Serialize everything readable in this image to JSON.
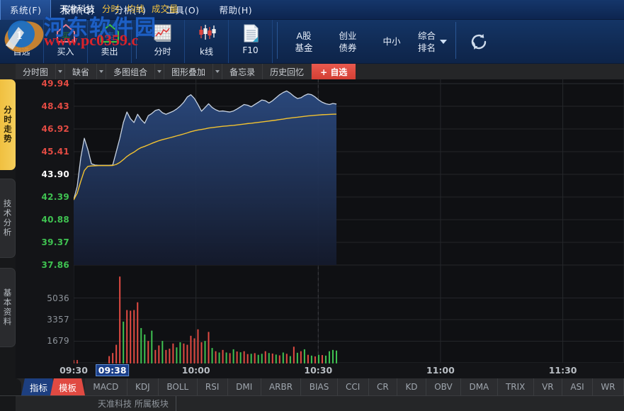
{
  "menu": {
    "items": [
      {
        "label": "系统(F)",
        "active": true
      },
      {
        "label": "报价(Q)",
        "active": false
      },
      {
        "label": "分析(T)",
        "active": false
      },
      {
        "label": "工具(O)",
        "active": false
      },
      {
        "label": "帮助(H)",
        "active": false
      }
    ]
  },
  "watermark": {
    "site_name": "河东软件园",
    "site_url": "www.pc0359.c"
  },
  "toolbar": {
    "icon_buttons": [
      {
        "label": "自选",
        "icon": "cart-icon"
      },
      {
        "label": "买入",
        "icon": "buy-house-icon"
      },
      {
        "label": "卖出",
        "icon": "sell-house-icon"
      },
      {
        "label": "分时",
        "icon": "timeline-chart-icon"
      },
      {
        "label": "k线",
        "icon": "candlestick-icon"
      },
      {
        "label": "F10",
        "icon": "document-icon"
      }
    ],
    "market_buttons": [
      {
        "line1": "A股",
        "line2": "基金"
      },
      {
        "line1": "创业",
        "line2": "债券"
      }
    ],
    "single_buttons": [
      {
        "label": "中小"
      }
    ],
    "rank_button": {
      "line1": "综合",
      "line2": "排名",
      "icon": "chevron-down-icon"
    },
    "refresh_button": {
      "icon": "refresh-icon"
    }
  },
  "subbar": {
    "buttons": [
      {
        "label": "分时图",
        "has_arrow": true
      },
      {
        "label": "缺省",
        "has_arrow": true
      },
      {
        "label": "多图组合",
        "has_arrow": true
      },
      {
        "label": "图形叠加",
        "has_arrow": true
      },
      {
        "label": "备忘录",
        "has_arrow": false
      },
      {
        "label": "历史回忆",
        "has_arrow": false
      }
    ],
    "add_favorite": "+ 自选"
  },
  "side_tabs": [
    {
      "label": "分时走势",
      "selected": true
    },
    {
      "label": "技术分析",
      "selected": false
    },
    {
      "label": "基本资料",
      "selected": false
    }
  ],
  "chart_header": {
    "stock_name": "天准科技",
    "tags": [
      "分时",
      "均线",
      "成交量"
    ]
  },
  "status_bar": {
    "text": "天准科技  所属板块"
  },
  "indicator_bar": {
    "tabs": [
      {
        "label": "指标",
        "style": "blue"
      },
      {
        "label": "模板",
        "style": "red"
      }
    ],
    "buttons": [
      "MACD",
      "KDJ",
      "BOLL",
      "RSI",
      "DMI",
      "ARBR",
      "BIAS",
      "CCI",
      "CR",
      "KD",
      "OBV",
      "DMA",
      "TRIX",
      "VR",
      "ASI",
      "WR"
    ]
  },
  "colors": {
    "up_red": "#e24b43",
    "down_green": "#3fc251",
    "neutral_white": "#ffffff",
    "avg_line_yellow": "#f2c230",
    "price_line": "#c8d3e2",
    "fill_blue": "#1d3b6e",
    "accent_gold": "#f0c040",
    "accent_red": "#d43f34",
    "menu_blue": "#15366b"
  },
  "chart_data": {
    "type": "line",
    "title": "天准科技 分时走势",
    "xlabel": "",
    "ylabel": "",
    "grid": true,
    "time_ticks": [
      {
        "label": "09:30",
        "x_frac": 0.0,
        "highlight": false
      },
      {
        "label": "09:38",
        "x_frac": 0.0704,
        "highlight": true
      },
      {
        "label": "10:00",
        "x_frac": 0.2222,
        "highlight": false
      },
      {
        "label": "10:30",
        "x_frac": 0.4444,
        "highlight": false
      },
      {
        "label": "11:00",
        "x_frac": 0.6666,
        "highlight": false
      },
      {
        "label": "11:30",
        "x_frac": 0.8888,
        "highlight": false
      }
    ],
    "price_axis": {
      "labels": [
        "49.94",
        "48.43",
        "46.92",
        "45.41",
        "43.90",
        "42.39",
        "40.88",
        "39.37",
        "37.86"
      ],
      "colors": [
        "#e24b43",
        "#e24b43",
        "#e24b43",
        "#e24b43",
        "#ffffff",
        "#3fc251",
        "#3fc251",
        "#3fc251",
        "#3fc251"
      ],
      "prev_close": 43.9,
      "ymax": 49.94,
      "ymin": 37.86
    },
    "volume_axis": {
      "labels": [
        "5036",
        "3357",
        "1679"
      ],
      "color": "#8e949b",
      "ymax": 6715
    },
    "series": [
      {
        "name": "分时",
        "color": "#c8d3e2",
        "values": [
          42.2,
          43.1,
          45.0,
          46.3,
          45.55,
          44.6,
          44.52,
          44.5,
          44.5,
          44.5,
          44.5,
          44.52,
          45.4,
          46.3,
          47.35,
          48.05,
          47.6,
          47.35,
          47.9,
          47.55,
          47.3,
          47.8,
          47.95,
          48.15,
          48.22,
          48.0,
          47.9,
          48.0,
          48.1,
          48.25,
          48.45,
          48.7,
          49.05,
          49.2,
          48.95,
          48.55,
          48.1,
          48.35,
          48.6,
          48.35,
          48.2,
          48.1,
          48.12,
          48.08,
          48.05,
          48.12,
          48.25,
          48.4,
          48.55,
          48.5,
          48.4,
          48.55,
          48.7,
          48.85,
          48.8,
          48.65,
          48.8,
          49.0,
          49.2,
          49.35,
          49.45,
          49.3,
          49.1,
          48.95,
          49.0,
          49.15,
          49.25,
          49.2,
          49.05,
          48.85,
          48.7,
          48.6,
          48.55,
          48.62,
          48.58
        ]
      },
      {
        "name": "均线",
        "color": "#f2c230",
        "values": [
          42.2,
          42.65,
          43.43,
          44.15,
          44.43,
          44.46,
          44.47,
          44.48,
          44.48,
          44.48,
          44.48,
          44.49,
          44.56,
          44.69,
          44.88,
          45.09,
          45.25,
          45.38,
          45.55,
          45.68,
          45.76,
          45.86,
          45.96,
          46.05,
          46.14,
          46.21,
          46.27,
          46.33,
          46.39,
          46.46,
          46.52,
          46.59,
          46.66,
          46.74,
          46.8,
          46.85,
          46.89,
          46.93,
          46.98,
          47.01,
          47.04,
          47.07,
          47.1,
          47.12,
          47.14,
          47.16,
          47.19,
          47.22,
          47.25,
          47.28,
          47.3,
          47.33,
          47.36,
          47.39,
          47.42,
          47.45,
          47.48,
          47.51,
          47.55,
          47.58,
          47.62,
          47.65,
          47.68,
          47.7,
          47.73,
          47.76,
          47.79,
          47.81,
          47.83,
          47.85,
          47.87,
          47.88,
          47.89,
          47.9,
          47.91
        ]
      }
    ],
    "volume": {
      "name": "成交量",
      "values": [
        120,
        40,
        0,
        0,
        0,
        0,
        0,
        0,
        0,
        0,
        520,
        760,
        1400,
        6700,
        3200,
        4100,
        4050,
        4100,
        4700,
        2700,
        2200,
        1700,
        2500,
        1000,
        1350,
        1700,
        1000,
        1100,
        1500,
        1200,
        1600,
        1500,
        1400,
        2100,
        1900,
        2600,
        1600,
        1700,
        2400,
        1150,
        900,
        800,
        1000,
        800,
        750,
        1050,
        880,
        820,
        900,
        680,
        700,
        750,
        620,
        700,
        900,
        760,
        720,
        640,
        580,
        800,
        700,
        520,
        1250,
        780,
        900,
        1050,
        620,
        560,
        500,
        620,
        600,
        560,
        900,
        1000,
        950
      ],
      "colors": [
        "red",
        "red",
        "none",
        "none",
        "none",
        "none",
        "none",
        "none",
        "none",
        "none",
        "red",
        "red",
        "red",
        "red",
        "green",
        "red",
        "red",
        "red",
        "red",
        "green",
        "green",
        "red",
        "green",
        "red",
        "red",
        "green",
        "red",
        "red",
        "red",
        "green",
        "green",
        "red",
        "red",
        "red",
        "red",
        "red",
        "red",
        "green",
        "red",
        "green",
        "red",
        "green",
        "red",
        "green",
        "red",
        "green",
        "red",
        "green",
        "red",
        "red",
        "green",
        "red",
        "green",
        "green",
        "red",
        "green",
        "red",
        "green",
        "red",
        "green",
        "red",
        "green",
        "red",
        "green",
        "red",
        "green",
        "red",
        "green",
        "red",
        "green",
        "red",
        "green",
        "green",
        "green",
        "green"
      ]
    }
  }
}
